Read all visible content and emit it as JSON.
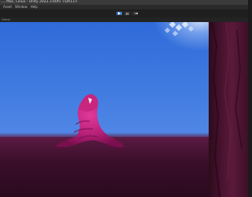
{
  "window": {
    "title": "..., Mac, Linux - Unity 2022.3.60f1 <DX11>"
  },
  "menubar": {
    "items": [
      {
        "label": "Asset"
      },
      {
        "label": "Window"
      },
      {
        "label": "Help"
      }
    ]
  },
  "toolbar": {
    "play_icon": "play-icon",
    "pause_icon": "pause-icon",
    "step_icon": "step-icon",
    "play_active": true
  },
  "game_view": {
    "tab_label": "Game"
  },
  "colors": {
    "sky": "#3f7ae0",
    "ground": "#3a0f2a",
    "character": "#d42c8a",
    "play_active": "#3a78c8"
  }
}
